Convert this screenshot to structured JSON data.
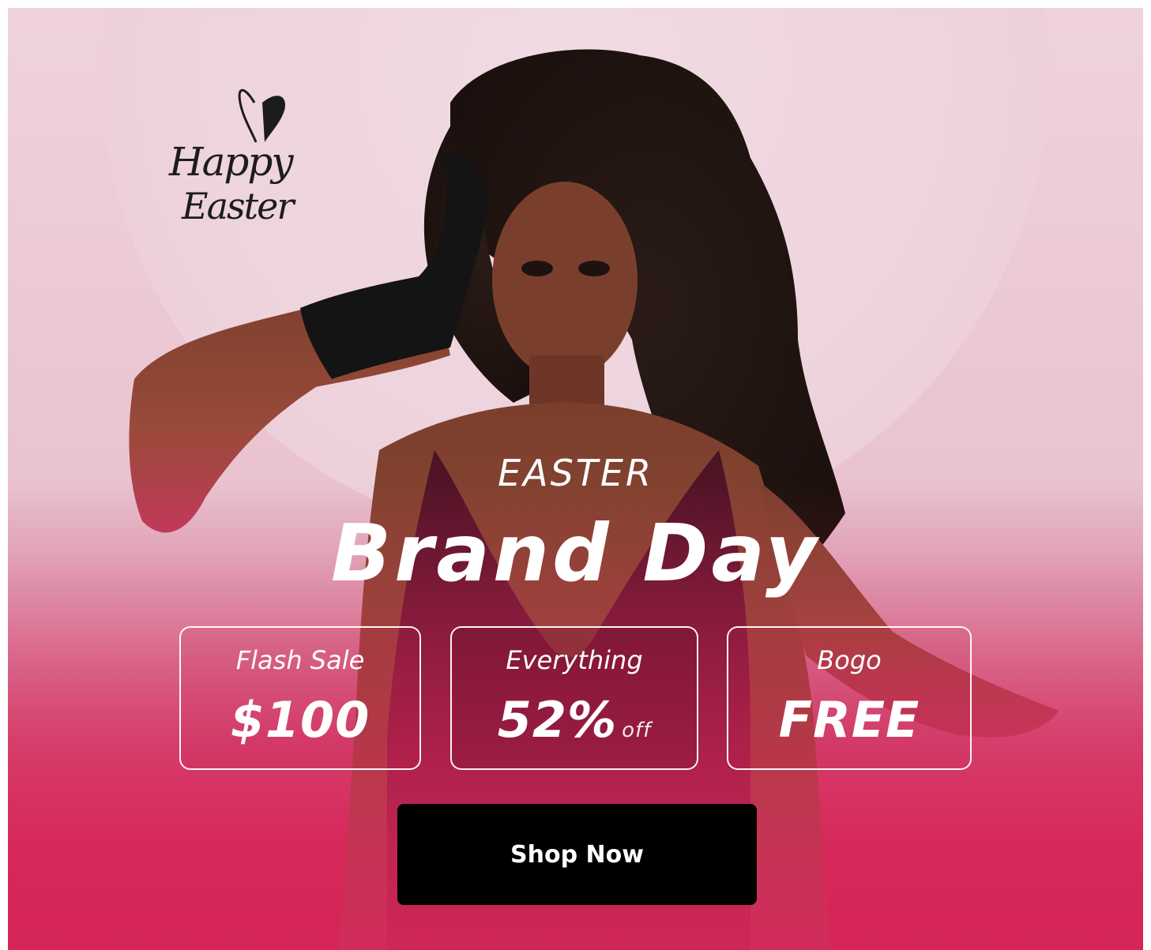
{
  "banner": {
    "logo": {
      "line1": "Happy",
      "line2": "Easter"
    },
    "eyebrow": "EASTER",
    "headline": "Brand Day",
    "offers": [
      {
        "label": "Flash Sale",
        "value": "$100",
        "suffix": ""
      },
      {
        "label": "Everything",
        "value": "52%",
        "suffix": "off"
      },
      {
        "label": "Bogo",
        "value": "FREE",
        "suffix": ""
      }
    ],
    "cta_label": "Shop Now"
  },
  "colors": {
    "accent": "#d41f51",
    "button": "#000000",
    "text": "#ffffff"
  }
}
